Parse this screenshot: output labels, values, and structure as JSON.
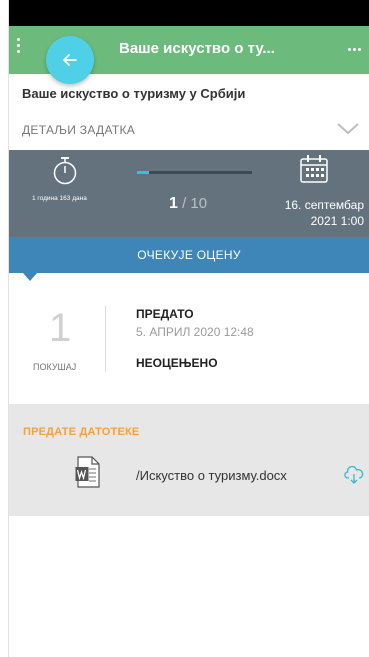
{
  "app_bar": {
    "title": "Ваше искуство о ту...",
    "back_icon": "arrow-left-icon",
    "overflow_icon": "more-horizontal-icon",
    "menu_icon": "more-vertical-icon"
  },
  "assignment": {
    "title": "Ваше искуство о туризму у Србији",
    "details_label": "ДЕТАЉИ ЗАДАТКА"
  },
  "stats": {
    "time_elapsed": "1 година 163 дана",
    "attempt_current": "1",
    "attempt_total": " / 10",
    "attempt_progress": 0.1,
    "due_line1": "16. септембар",
    "due_line2": "2021 1:00"
  },
  "status": {
    "label": "ОЧЕКУЈЕ ОЦЕНУ"
  },
  "attempt": {
    "number": "1",
    "number_label": "ПОКУШАЈ",
    "submitted_label": "ПРЕДАТО",
    "submitted_date": "5. АПРИЛ 2020 12:48",
    "grade_status": "НЕОЦЕЊЕНО"
  },
  "files": {
    "header": "ПРЕДАТЕ ДАТОТЕКЕ",
    "items": [
      {
        "name": "/Искуство о туризму.docx",
        "icon": "word-document-icon"
      }
    ]
  },
  "colors": {
    "app_bar": "#6dbb7c",
    "fab": "#4fd0e6",
    "stats_bg": "#63727d",
    "status_banner": "#3e86b7",
    "files_header": "#f5a03a",
    "files_bg": "#e7e7e7"
  }
}
